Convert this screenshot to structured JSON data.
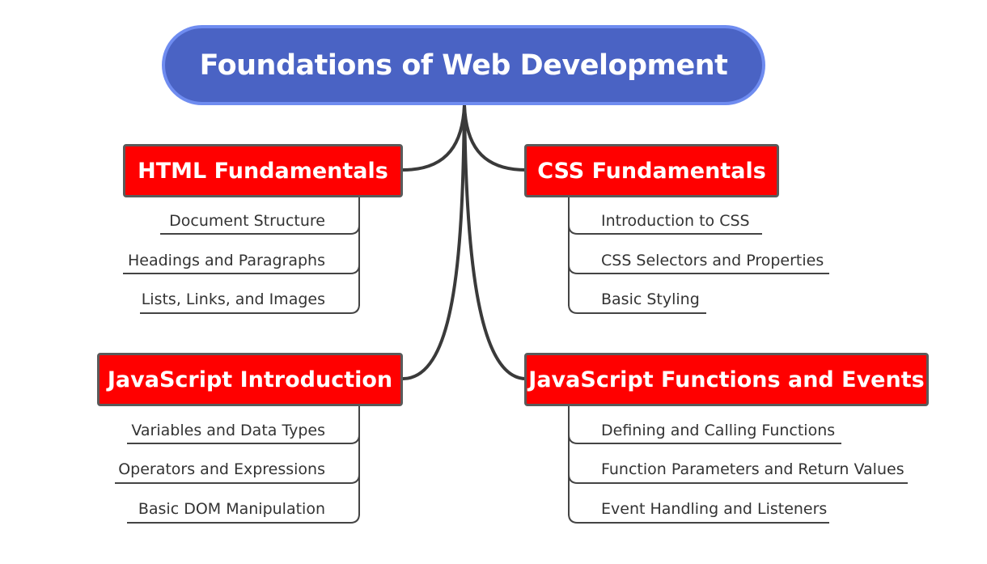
{
  "root": {
    "label": "Foundations of Web Development"
  },
  "branches": [
    {
      "label": "HTML Fundamentals",
      "items": [
        "Document Structure",
        "Headings and Paragraphs",
        "Lists, Links, and Images"
      ]
    },
    {
      "label": "CSS Fundamentals",
      "items": [
        "Introduction to CSS",
        "CSS Selectors and Properties",
        "Basic Styling"
      ]
    },
    {
      "label": "JavaScript Introduction",
      "items": [
        "Variables and Data Types",
        "Operators and Expressions",
        "Basic DOM Manipulation"
      ]
    },
    {
      "label": "JavaScript Functions and Events",
      "items": [
        "Defining and Calling Functions",
        "Function Parameters and Return Values",
        "Event Handling and Listeners"
      ]
    }
  ],
  "colors": {
    "root_fill": "#4a63c4",
    "root_border": "#6f8cf0",
    "branch_fill": "#ff0000",
    "branch_border": "#5a5a5a",
    "connector": "#3a3a3a"
  }
}
